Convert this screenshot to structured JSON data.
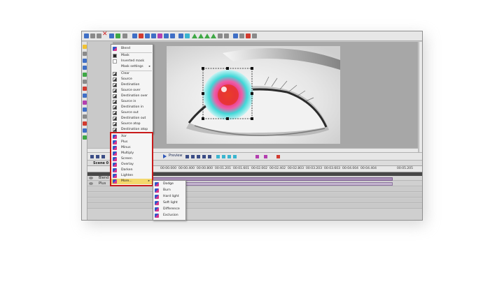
{
  "toolbar": {
    "icons": [
      "new-icon",
      "open-icon",
      "save-icon",
      "delete-icon",
      "zoom-icon",
      "refresh-icon",
      "undo-icon",
      "layout-icon",
      "frame-icon",
      "align-icon",
      "distribute-icon",
      "move-up-icon",
      "move-down-icon",
      "lock-icon",
      "preview-icon",
      "settings-icon"
    ]
  },
  "menu": {
    "items": [
      {
        "label": "Blend",
        "icon": "blend-icon"
      },
      {
        "label": "Mask",
        "icon": "mask-icon"
      },
      {
        "label": "Inverted mask",
        "icon": "inverted-mask-icon"
      },
      {
        "label": "Mask settings",
        "icon": "mask-settings-icon",
        "has_submenu": true
      },
      {
        "label": "Clear",
        "icon": "op-icon"
      },
      {
        "label": "Source",
        "icon": "op-icon"
      },
      {
        "label": "Destination",
        "icon": "op-icon"
      },
      {
        "label": "Source over",
        "icon": "op-icon"
      },
      {
        "label": "Destination over",
        "icon": "op-icon"
      },
      {
        "label": "Source in",
        "icon": "op-icon"
      },
      {
        "label": "Destination in",
        "icon": "op-icon"
      },
      {
        "label": "Source out",
        "icon": "op-icon"
      },
      {
        "label": "Destination out",
        "icon": "op-icon"
      },
      {
        "label": "Source atop",
        "icon": "op-icon"
      },
      {
        "label": "Destination atop",
        "icon": "op-icon"
      }
    ],
    "blend_items": [
      {
        "label": "Xor",
        "icon": "blend-icon"
      },
      {
        "label": "Plus",
        "icon": "blend-icon"
      },
      {
        "label": "Minus",
        "icon": "blend-icon"
      },
      {
        "label": "Multiply",
        "icon": "blend-icon"
      },
      {
        "label": "Screen",
        "icon": "blend-icon"
      },
      {
        "label": "Overlay",
        "icon": "blend-icon"
      },
      {
        "label": "Darken",
        "icon": "blend-icon"
      },
      {
        "label": "Lighten",
        "icon": "blend-icon"
      },
      {
        "label": "More...",
        "icon": "blend-icon",
        "has_submenu": true,
        "highlighted": true
      }
    ]
  },
  "submenu": {
    "items": [
      {
        "label": "Dodge",
        "icon": "blend-icon"
      },
      {
        "label": "Burn",
        "icon": "blend-icon"
      },
      {
        "label": "Hard light",
        "icon": "blend-icon"
      },
      {
        "label": "Soft light",
        "icon": "blend-icon"
      },
      {
        "label": "Difference",
        "icon": "blend-icon"
      },
      {
        "label": "Exclusion",
        "icon": "blend-icon"
      }
    ]
  },
  "playback": {
    "preview_label": "Preview"
  },
  "timeline": {
    "scene_label": "Scene 0",
    "ticks": [
      "00:00.000",
      "00:00.400",
      "00:00.800",
      "00:01.201",
      "00:01.601",
      "00:02.002",
      "00:02.402",
      "00:02.803",
      "00:03.203",
      "00:03.603",
      "00:04.004",
      "00:04.404",
      "00:05.205"
    ],
    "tracks": [
      {
        "name": "Blend"
      },
      {
        "name": "Plus"
      }
    ]
  },
  "colors": {
    "highlight_frame": "#c81a1a",
    "menu_highlight": "#f3d86d",
    "clip_purple": "#a88fb6",
    "iris_magenta": "#e6307a",
    "iris_cyan": "#3fd8d8"
  }
}
